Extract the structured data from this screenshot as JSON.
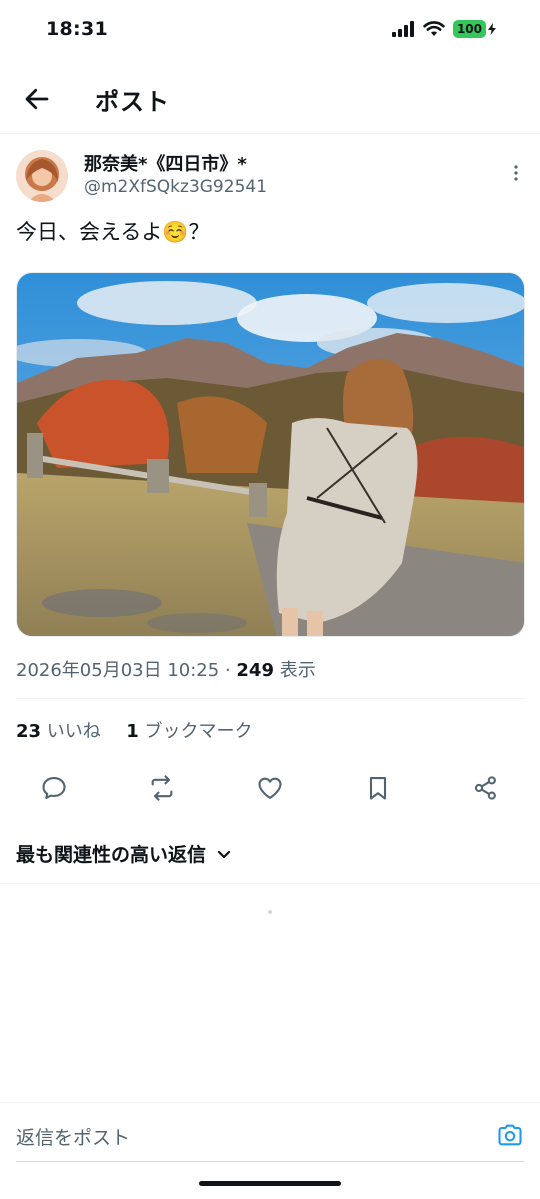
{
  "status_bar": {
    "time": "18:31",
    "battery": "100"
  },
  "nav": {
    "title": "ポスト"
  },
  "author": {
    "name": "那奈美*《四日市》*",
    "handle": "@m2XfSQkz3G92541"
  },
  "post": {
    "text": "今日、会えるよ☺️？"
  },
  "meta": {
    "datetime": "2026年05月03日 10:25",
    "separator": " · ",
    "views": "249",
    "views_label": " 表示"
  },
  "stats": {
    "likes": "23",
    "likes_label": " いいね",
    "bookmarks": "1",
    "bookmarks_label": " ブックマーク"
  },
  "sort": {
    "label": "最も関連性の高い返信"
  },
  "reply": {
    "placeholder": "返信をポスト"
  },
  "colors": {
    "text": "#0f1419",
    "secondary": "#536471",
    "accent": "#1d9bf0",
    "battery": "#34c759"
  }
}
